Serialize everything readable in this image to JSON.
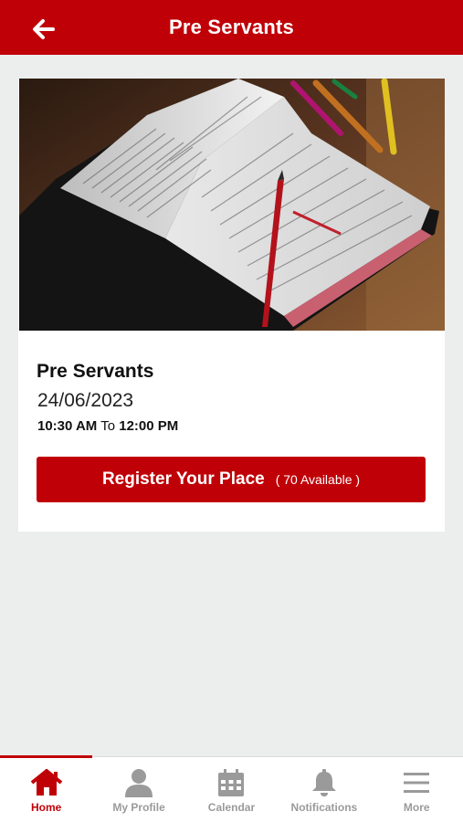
{
  "header": {
    "title": "Pre Servants",
    "back_icon": "arrow-left-icon"
  },
  "event": {
    "image_subject": "open-bible-with-pencils",
    "title": "Pre Servants",
    "date": "24/06/2023",
    "start_time": "10:30 AM",
    "time_separator": "To",
    "end_time": "12:00 PM",
    "register_label": "Register Your Place",
    "available": "( 70 Available )"
  },
  "tabs": [
    {
      "label": "Home",
      "icon": "home-icon",
      "active": true
    },
    {
      "label": "My Profile",
      "icon": "user-icon",
      "active": false
    },
    {
      "label": "Calendar",
      "icon": "calendar-icon",
      "active": false
    },
    {
      "label": "Notifications",
      "icon": "bell-icon",
      "active": false
    },
    {
      "label": "More",
      "icon": "menu-icon",
      "active": false
    }
  ],
  "colors": {
    "brand": "#c00007",
    "background": "#eceeee",
    "tab_inactive": "#9a9a9a"
  }
}
